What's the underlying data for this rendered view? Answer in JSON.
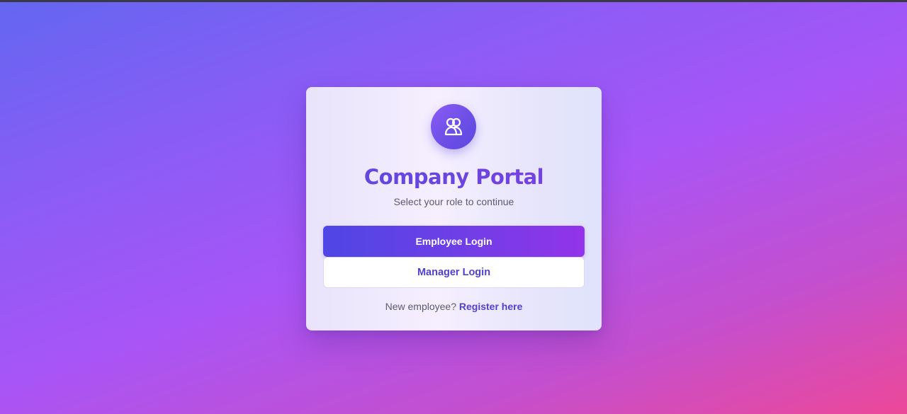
{
  "portal": {
    "icon": "users-icon",
    "title": "Company Portal",
    "subtitle": "Select your role to continue",
    "employee_login_label": "Employee Login",
    "manager_login_label": "Manager Login",
    "footer_text": "New employee?",
    "register_link_label": "Register here"
  },
  "colors": {
    "background_start": "#6366f1",
    "background_mid": "#a855f7",
    "background_end": "#ec4899",
    "accent": "#5040d0",
    "primary_button_start": "#4f46e5",
    "primary_button_end": "#9333ea"
  }
}
